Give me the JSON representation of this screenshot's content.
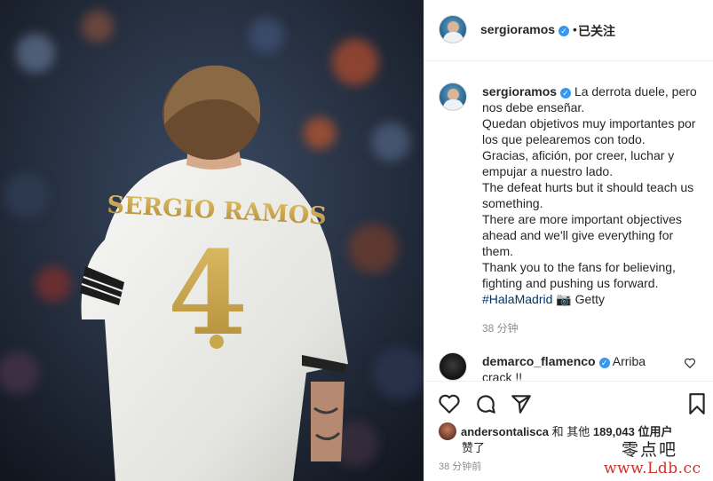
{
  "post": {
    "username": "sergioramos",
    "verified_icon": "verified-badge-icon",
    "follow_status": "已关注",
    "jersey_name": "SERGIO RAMOS",
    "jersey_number": "4",
    "caption_lines": [
      "La derrota duele, pero nos debe enseñar.",
      "Quedan objetivos muy importantes por los que pelearemos con todo.",
      "Gracias, afición, por creer, luchar y empujar a nuestro lado.",
      "The defeat hurts but it should teach us something.",
      "There are more important objectives ahead and we'll give everything for them.",
      "Thank you to the fans for believing, fighting and pushing us forward."
    ],
    "hashtag": "#HalaMadrid",
    "camera_icon": "camera-icon",
    "photo_credit": "Getty",
    "caption_time": "38 分钟",
    "comment": {
      "username": "demarco_flamenco",
      "text": "Arriba crack !!"
    },
    "likes": {
      "liker": "andersontalisca",
      "connector": "和 其他",
      "count": "189,043",
      "suffix": "位用户",
      "suffix2": "赞了"
    },
    "post_time": "38 分钟前"
  },
  "icons": [
    "heart-icon",
    "comment-icon",
    "share-icon",
    "bookmark-icon",
    "small-heart-icon"
  ],
  "watermark": {
    "top": "零点吧",
    "bottom": "www.Ldb.cc"
  },
  "colors": {
    "link": "#003569",
    "verified": "#3897f0",
    "muted": "#8e8e8e",
    "gold": "#c9a74b",
    "watermark_red": "#d0302a"
  }
}
